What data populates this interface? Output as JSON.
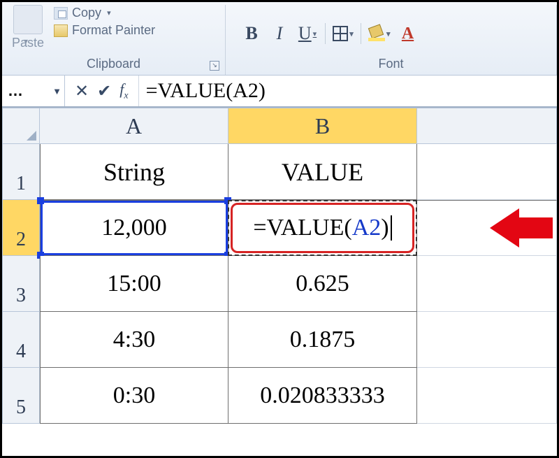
{
  "ribbon": {
    "clipboard": {
      "paste_label": "Paste",
      "copy_label": "Copy",
      "copy_dd": "▾",
      "format_painter_label": "Format Painter",
      "group_label": "Clipboard"
    },
    "font": {
      "bold": "B",
      "italic": "I",
      "underline": "U",
      "fontcolor": "A",
      "group_label": "Font"
    }
  },
  "formula_bar": {
    "name_box": "…",
    "cancel": "✕",
    "enter": "✔",
    "formula_text": "=VALUE(A2)"
  },
  "grid": {
    "columns": [
      "A",
      "B"
    ],
    "rows": [
      {
        "num": "1",
        "A": "String",
        "B": "VALUE"
      },
      {
        "num": "2",
        "A": "12,000",
        "B_formula_prefix": "=VALUE",
        "B_formula_ref": "A2"
      },
      {
        "num": "3",
        "A": "15:00",
        "B": "0.625"
      },
      {
        "num": "4",
        "A": "4:30",
        "B": "0.1875"
      },
      {
        "num": "5",
        "A": "0:30",
        "B": "0.020833333"
      }
    ]
  }
}
